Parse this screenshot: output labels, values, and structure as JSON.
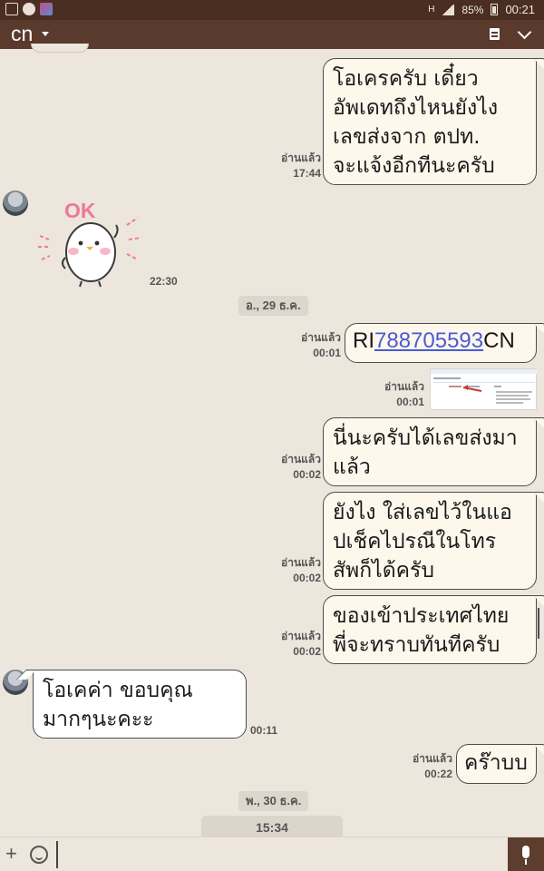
{
  "status_bar": {
    "battery": "85%",
    "time": "00:21",
    "network": "H"
  },
  "header": {
    "title": "cn"
  },
  "messages": {
    "m1": {
      "lines": [
        "โอเครครับ เดี๋ยว",
        "อัพเดทถึงไหนยังไง",
        "เลขส่งจาก ตปท.",
        "จะแจ้งอีกทีนะครับ"
      ],
      "read": "อ่านแล้ว",
      "time": "17:44"
    },
    "sticker": {
      "text": "OK",
      "time": "22:30"
    },
    "date1": "อ., 29 ธ.ค.",
    "m2": {
      "prefix": "RI",
      "link": "788705593",
      "suffix": "CN",
      "read": "อ่านแล้ว",
      "time": "00:01"
    },
    "m3": {
      "read": "อ่านแล้ว",
      "time": "00:01"
    },
    "m4": {
      "lines": [
        "นี่นะครับได้เลขส่งมา",
        "แล้ว"
      ],
      "read": "อ่านแล้ว",
      "time": "00:02"
    },
    "m5": {
      "lines": [
        "ยังไง ใส่เลขไว้ในแอ",
        "ปเช็คไปรณีในโทร",
        "สัพก็ได้ครับ"
      ],
      "read": "อ่านแล้ว",
      "time": "00:02"
    },
    "m6": {
      "lines": [
        "ของเข้าประเทศไทย",
        "พี่จะทราบทันทีครับ"
      ],
      "read": "อ่านแล้ว",
      "time": "00:02"
    },
    "m7": {
      "lines": [
        "โอเคค่า ขอบคุณ",
        "มากๆนะคะะ"
      ],
      "time": "00:11"
    },
    "m8": {
      "text": "คร๊าบบ",
      "read": "อ่านแล้ว",
      "time": "00:22"
    },
    "date2": "พ., 30 ธ.ค.",
    "last_time": "15:34"
  },
  "colors": {
    "header": "#5a3a2c",
    "status_bar": "#4a2e22",
    "background": "#ece6dd",
    "link": "#4a5bd6"
  },
  "icons": {
    "menu": "list-icon",
    "collapse": "chevron-down-icon",
    "attach": "plus-icon",
    "emoji": "smiley-icon",
    "voice": "mic-icon"
  }
}
